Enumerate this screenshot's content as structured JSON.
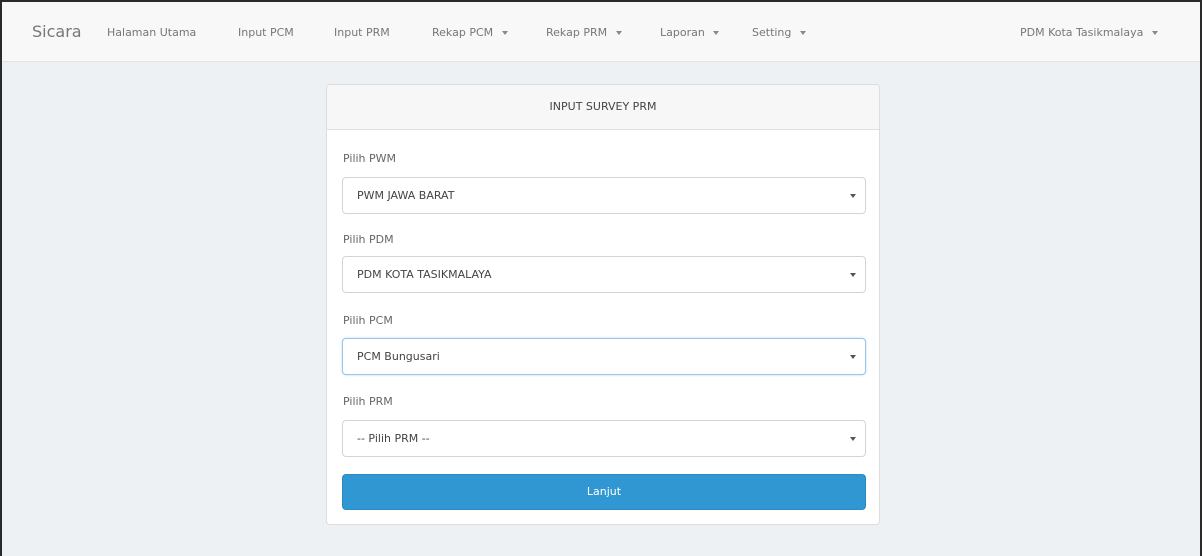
{
  "navbar": {
    "brand": "Sicara",
    "items": [
      {
        "label": "Halaman Utama",
        "dropdown": false
      },
      {
        "label": "Input PCM",
        "dropdown": false
      },
      {
        "label": "Input PRM",
        "dropdown": false
      },
      {
        "label": "Rekap PCM",
        "dropdown": true
      },
      {
        "label": "Rekap PRM",
        "dropdown": true
      },
      {
        "label": "Laporan",
        "dropdown": true
      },
      {
        "label": "Setting",
        "dropdown": true
      }
    ],
    "user_menu": {
      "label": "PDM Kota Tasikmalaya",
      "dropdown": true
    }
  },
  "panel": {
    "title": "INPUT SURVEY PRM",
    "fields": [
      {
        "label": "Pilih PWM",
        "value": "PWM JAWA BARAT"
      },
      {
        "label": "Pilih PDM",
        "value": "PDM KOTA TASIKMALAYA"
      },
      {
        "label": "Pilih PCM",
        "value": "PCM Bungusari"
      },
      {
        "label": "Pilih PRM",
        "value": "-- Pilih PRM --"
      }
    ],
    "submit_label": "Lanjut"
  },
  "colors": {
    "navbar_bg": "#f8f8f8",
    "page_bg": "#eef1f4",
    "button_bg": "#3197d3",
    "focus_border": "#9cc5e8"
  }
}
